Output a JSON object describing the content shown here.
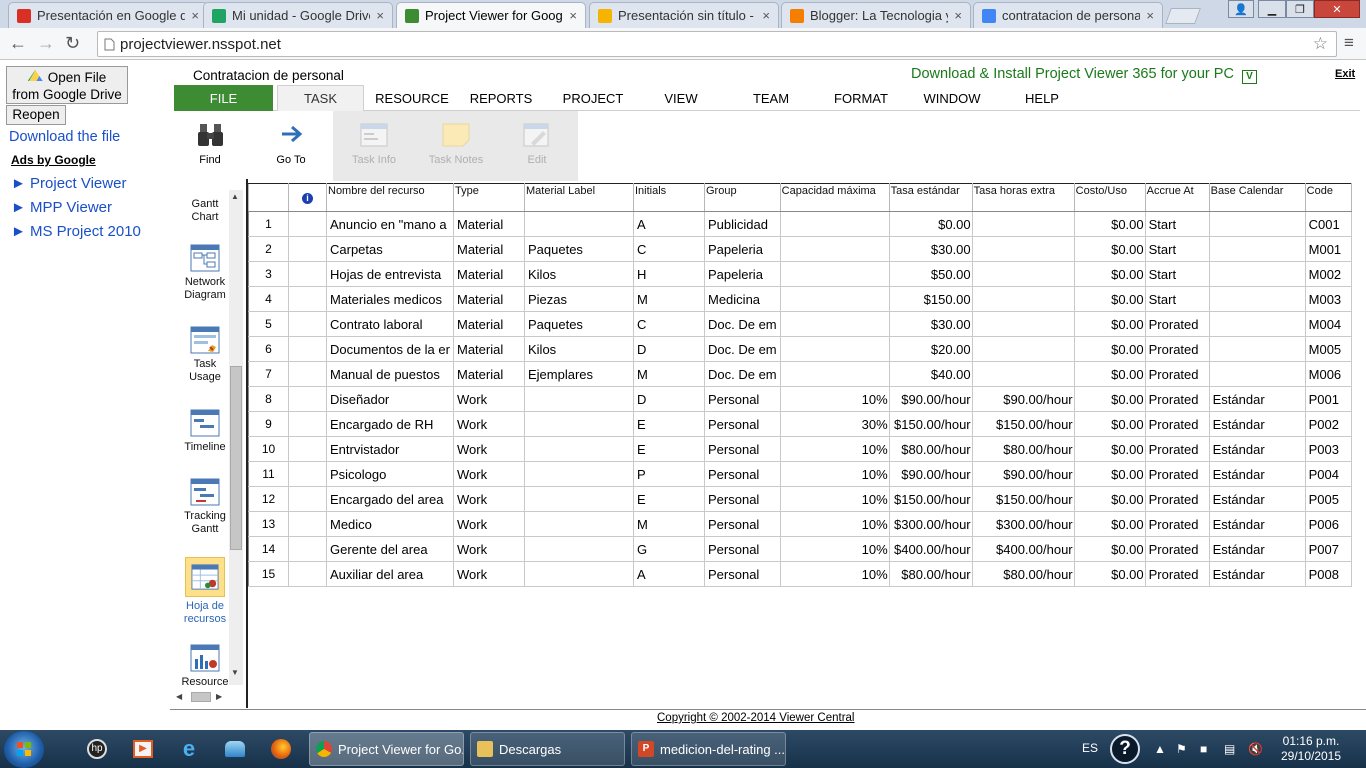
{
  "browser": {
    "tabs": [
      {
        "title": "Presentación en Google d",
        "icon": "gmail-icon",
        "color": "#d93025"
      },
      {
        "title": "Mi unidad - Google Drive",
        "icon": "drive-icon",
        "color": "#1fa463"
      },
      {
        "title": "Project Viewer for Google",
        "icon": "project-viewer-icon",
        "color": "#3d8c33",
        "active": true
      },
      {
        "title": "Presentación sin título - Pr",
        "icon": "slides-icon",
        "color": "#f4b400"
      },
      {
        "title": "Blogger: La Tecnologia y s",
        "icon": "blogger-icon",
        "color": "#f57d00"
      },
      {
        "title": "contratacion de personal",
        "icon": "google-icon",
        "color": "#4285f4"
      }
    ],
    "url": "projectviewer.nsspot.net"
  },
  "left_panel": {
    "open_button": [
      "Open File",
      "from Google Drive"
    ],
    "reopen": "Reopen",
    "download": "Download the file",
    "ads_label": "Ads by Google",
    "ads": [
      "► Project Viewer",
      "► MPP Viewer",
      "► MS Project 2010"
    ]
  },
  "app": {
    "project_title": "Contratacion de personal",
    "promo": "Download & Install Project Viewer 365 for your PC",
    "exit": "Exit",
    "ribbon_tabs": [
      "FILE",
      "TASK",
      "RESOURCE",
      "REPORTS",
      "PROJECT",
      "VIEW",
      "TEAM",
      "FORMAT",
      "WINDOW",
      "HELP"
    ],
    "ribbon_buttons": {
      "find": "Find",
      "goto": "Go To",
      "task_info": "Task Info",
      "task_notes": "Task Notes",
      "edit": "Edit"
    },
    "views": [
      "Gantt Chart",
      "Network Diagram",
      "Task Usage",
      "Timeline",
      "Tracking Gantt",
      "Hoja de recursos",
      "Resource"
    ],
    "footer": "Copyright © 2002-2014 Viewer Central"
  },
  "grid": {
    "columns": [
      "",
      "",
      "Nombre del recurso",
      "Type",
      "Material Label",
      "Initials",
      "Group",
      "Capacidad máxima",
      "Tasa estándar",
      "Tasa horas extra",
      "Costo/Uso",
      "Accrue At",
      "Base Calendar",
      "Code"
    ],
    "rows": [
      [
        "1",
        "",
        "Anuncio en \"mano a",
        "Material",
        "",
        "A",
        "Publicidad",
        "",
        "$0.00",
        "",
        "$0.00",
        "Start",
        "",
        "C001"
      ],
      [
        "2",
        "",
        "Carpetas",
        "Material",
        "Paquetes",
        "C",
        "Papeleria",
        "",
        "$30.00",
        "",
        "$0.00",
        "Start",
        "",
        "M001"
      ],
      [
        "3",
        "",
        "Hojas de entrevista",
        "Material",
        "Kilos",
        "H",
        "Papeleria",
        "",
        "$50.00",
        "",
        "$0.00",
        "Start",
        "",
        "M002"
      ],
      [
        "4",
        "",
        "Materiales medicos",
        "Material",
        "Piezas",
        "M",
        "Medicina",
        "",
        "$150.00",
        "",
        "$0.00",
        "Start",
        "",
        "M003"
      ],
      [
        "5",
        "",
        "Contrato laboral",
        "Material",
        "Paquetes",
        "C",
        "Doc. De em",
        "",
        "$30.00",
        "",
        "$0.00",
        "Prorated",
        "",
        "M004"
      ],
      [
        "6",
        "",
        "Documentos de la er",
        "Material",
        "Kilos",
        "D",
        "Doc. De em",
        "",
        "$20.00",
        "",
        "$0.00",
        "Prorated",
        "",
        "M005"
      ],
      [
        "7",
        "",
        "Manual de puestos",
        "Material",
        "Ejemplares",
        "M",
        "Doc. De em",
        "",
        "$40.00",
        "",
        "$0.00",
        "Prorated",
        "",
        "M006"
      ],
      [
        "8",
        "",
        "Diseñador",
        "Work",
        "",
        "D",
        "Personal",
        "10%",
        "$90.00/hour",
        "$90.00/hour",
        "$0.00",
        "Prorated",
        "Estándar",
        "P001"
      ],
      [
        "9",
        "",
        "Encargado de RH",
        "Work",
        "",
        "E",
        "Personal",
        "30%",
        "$150.00/hour",
        "$150.00/hour",
        "$0.00",
        "Prorated",
        "Estándar",
        "P002"
      ],
      [
        "10",
        "",
        "Entrvistador",
        "Work",
        "",
        "E",
        "Personal",
        "10%",
        "$80.00/hour",
        "$80.00/hour",
        "$0.00",
        "Prorated",
        "Estándar",
        "P003"
      ],
      [
        "11",
        "",
        "Psicologo",
        "Work",
        "",
        "P",
        "Personal",
        "10%",
        "$90.00/hour",
        "$90.00/hour",
        "$0.00",
        "Prorated",
        "Estándar",
        "P004"
      ],
      [
        "12",
        "",
        "Encargado del area",
        "Work",
        "",
        "E",
        "Personal",
        "10%",
        "$150.00/hour",
        "$150.00/hour",
        "$0.00",
        "Prorated",
        "Estándar",
        "P005"
      ],
      [
        "13",
        "",
        "Medico",
        "Work",
        "",
        "M",
        "Personal",
        "10%",
        "$300.00/hour",
        "$300.00/hour",
        "$0.00",
        "Prorated",
        "Estándar",
        "P006"
      ],
      [
        "14",
        "",
        "Gerente del area",
        "Work",
        "",
        "G",
        "Personal",
        "10%",
        "$400.00/hour",
        "$400.00/hour",
        "$0.00",
        "Prorated",
        "Estándar",
        "P007"
      ],
      [
        "15",
        "",
        "Auxiliar del area",
        "Work",
        "",
        "A",
        "Personal",
        "10%",
        "$80.00/hour",
        "$80.00/hour",
        "$0.00",
        "Prorated",
        "Estándar",
        "P008"
      ]
    ]
  },
  "taskbar": {
    "buttons": [
      "Project Viewer for Go...",
      "Descargas",
      "medicion-del-rating ..."
    ],
    "lang": "ES",
    "time": "01:16 p.m.",
    "date": "29/10/2015"
  }
}
